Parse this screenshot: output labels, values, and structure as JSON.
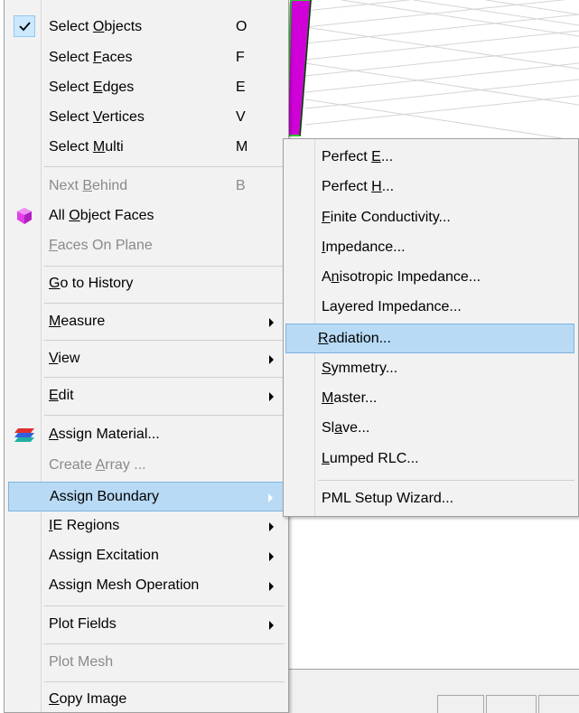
{
  "main_menu": {
    "items": [
      {
        "pre": "Select ",
        "mn": "O",
        "post": "bjects",
        "key": "O",
        "checked": true
      },
      {
        "pre": "Select ",
        "mn": "F",
        "post": "aces",
        "key": "F"
      },
      {
        "pre": "Select ",
        "mn": "E",
        "post": "dges",
        "key": "E"
      },
      {
        "pre": "Select ",
        "mn": "V",
        "post": "ertices",
        "key": "V"
      },
      {
        "pre": "Select ",
        "mn": "M",
        "post": "ulti",
        "key": "M"
      },
      {
        "pre": "Next ",
        "mn": "B",
        "post": "ehind",
        "key": "B",
        "disabled": true
      },
      {
        "pre": "All ",
        "mn": "O",
        "post": "bject Faces",
        "icon": "cube-icon"
      },
      {
        "pre": "",
        "mn": "F",
        "post": "aces On Plane",
        "disabled": true
      },
      {
        "pre": "",
        "mn": "G",
        "post": "o to History"
      },
      {
        "pre": "",
        "mn": "M",
        "post": "easure",
        "submenu": true
      },
      {
        "pre": "",
        "mn": "V",
        "post": "iew",
        "submenu": true
      },
      {
        "pre": "",
        "mn": "E",
        "post": "dit",
        "submenu": true
      },
      {
        "pre": "",
        "mn": "A",
        "post": "ssign Material...",
        "icon": "material-layers-icon"
      },
      {
        "pre": "Create ",
        "mn": "A",
        "post": "rray ...",
        "disabled": true
      },
      {
        "pre": "Assign Boundary",
        "mn": "",
        "post": "",
        "submenu": true,
        "selected": true
      },
      {
        "pre": "",
        "mn": "I",
        "post": "E Regions",
        "submenu": true
      },
      {
        "pre": "Assign Excitation",
        "mn": "",
        "post": "",
        "submenu": true
      },
      {
        "pre": "Assign Mesh Operation",
        "mn": "",
        "post": "",
        "submenu": true
      },
      {
        "pre": "Plot Fields",
        "mn": "",
        "post": "",
        "submenu": true
      },
      {
        "pre": "Plot Mesh",
        "mn": "",
        "post": "",
        "disabled": true
      },
      {
        "pre": "",
        "mn": "C",
        "post": "opy Image"
      }
    ]
  },
  "boundary_submenu": {
    "items": [
      {
        "pre": "Perfect ",
        "mn": "E",
        "post": "..."
      },
      {
        "pre": "Perfect ",
        "mn": "H",
        "post": "..."
      },
      {
        "pre": "",
        "mn": "F",
        "post": "inite Conductivity..."
      },
      {
        "pre": "",
        "mn": "I",
        "post": "mpedance..."
      },
      {
        "pre": "A",
        "mn": "n",
        "post": "isotropic Impedance..."
      },
      {
        "pre": "Layered Impedance...",
        "mn": "",
        "post": ""
      },
      {
        "pre": "",
        "mn": "R",
        "post": "adiation...",
        "selected": true
      },
      {
        "pre": "",
        "mn": "S",
        "post": "ymmetry..."
      },
      {
        "pre": "",
        "mn": "M",
        "post": "aster..."
      },
      {
        "pre": "Sl",
        "mn": "a",
        "post": "ve..."
      },
      {
        "pre": "",
        "mn": "L",
        "post": "umped RLC..."
      },
      {
        "pre": "PML Setup Wizard...",
        "mn": "",
        "post": ""
      }
    ]
  },
  "colors": {
    "highlight": "#b8daf5",
    "menu_bg": "#f2f2f2",
    "object_fill": "#d000d8",
    "object_edge": "#2ec82e"
  }
}
